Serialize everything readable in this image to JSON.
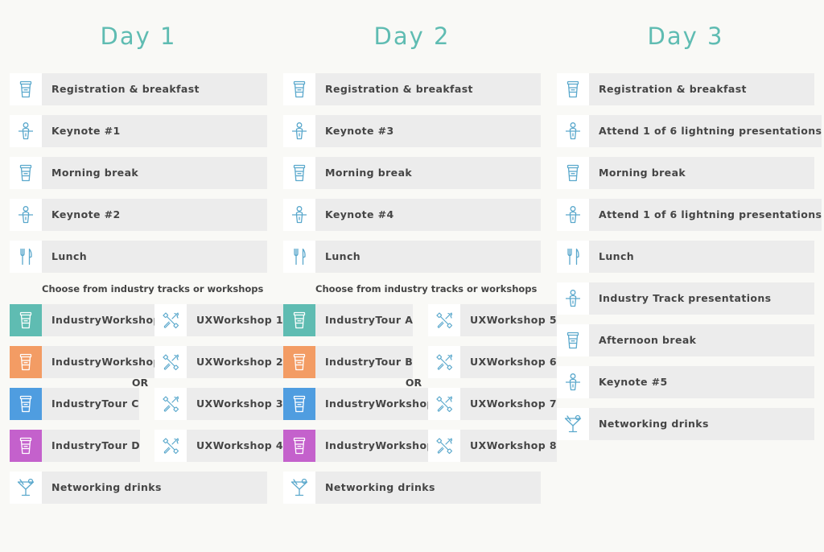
{
  "colors": {
    "title": "#5fbcb2",
    "icon_outline": "#5aa8cc",
    "teal": "#5fbcb2",
    "orange": "#f39c64",
    "blue": "#4f9de0",
    "purple": "#c461cc"
  },
  "days": [
    {
      "title": "Day 1",
      "sessions": [
        {
          "label": "Registration & breakfast",
          "icon": "coffee-cup-icon"
        },
        {
          "label": "Keynote #1",
          "icon": "speaker-podium-icon"
        },
        {
          "label": "Morning break",
          "icon": "coffee-cup-icon"
        },
        {
          "label": "Keynote #2",
          "icon": "speaker-podium-icon"
        },
        {
          "label": "Lunch",
          "icon": "fork-knife-icon"
        }
      ],
      "choose_text": "Choose from industry tracks or workshops",
      "or_text": "OR",
      "tracks": [
        {
          "label": "Industry\nWorkshop A",
          "color": "#5fbcb2",
          "icon": "coffee-cup-icon"
        },
        {
          "label": "Industry\nWorkshop B",
          "color": "#f39c64",
          "icon": "coffee-cup-icon"
        },
        {
          "label": "Industry\nTour C",
          "color": "#4f9de0",
          "icon": "coffee-cup-icon"
        },
        {
          "label": "Industry\nTour D",
          "color": "#c461cc",
          "icon": "coffee-cup-icon"
        }
      ],
      "workshops": [
        {
          "label": "UX\nWorkshop 1",
          "icon": "tools-icon"
        },
        {
          "label": "UX\nWorkshop 2",
          "icon": "tools-icon"
        },
        {
          "label": "UX\nWorkshop 3",
          "icon": "tools-icon"
        },
        {
          "label": "UX\nWorkshop 4",
          "icon": "tools-icon"
        }
      ],
      "closing": {
        "label": "Networking drinks",
        "icon": "cocktail-glass-icon"
      }
    },
    {
      "title": "Day 2",
      "sessions": [
        {
          "label": "Registration & breakfast",
          "icon": "coffee-cup-icon"
        },
        {
          "label": "Keynote #3",
          "icon": "speaker-podium-icon"
        },
        {
          "label": "Morning break",
          "icon": "coffee-cup-icon"
        },
        {
          "label": "Keynote #4",
          "icon": "speaker-podium-icon"
        },
        {
          "label": "Lunch",
          "icon": "fork-knife-icon"
        }
      ],
      "choose_text": "Choose from industry tracks or workshops",
      "or_text": "OR",
      "tracks": [
        {
          "label": "Industry\nTour A",
          "color": "#5fbcb2",
          "icon": "coffee-cup-icon"
        },
        {
          "label": "Industry\nTour B",
          "color": "#f39c64",
          "icon": "coffee-cup-icon"
        },
        {
          "label": "Industry\nWorkshop C",
          "color": "#4f9de0",
          "icon": "coffee-cup-icon"
        },
        {
          "label": "Industry\nWorkshop D",
          "color": "#c461cc",
          "icon": "coffee-cup-icon"
        }
      ],
      "workshops": [
        {
          "label": "UX\nWorkshop 5",
          "icon": "tools-icon"
        },
        {
          "label": "UX\nWorkshop 6",
          "icon": "tools-icon"
        },
        {
          "label": "UX\nWorkshop 7",
          "icon": "tools-icon"
        },
        {
          "label": "UX\nWorkshop 8",
          "icon": "tools-icon"
        }
      ],
      "closing": {
        "label": "Networking drinks",
        "icon": "cocktail-glass-icon"
      }
    },
    {
      "title": "Day 3",
      "sessions": [
        {
          "label": "Registration & breakfast",
          "icon": "coffee-cup-icon"
        },
        {
          "label": "Attend 1 of 6 lightning presentations",
          "icon": "speaker-podium-icon"
        },
        {
          "label": "Morning break",
          "icon": "coffee-cup-icon"
        },
        {
          "label": "Attend 1 of 6 lightning presentations",
          "icon": "speaker-podium-icon"
        },
        {
          "label": "Lunch",
          "icon": "fork-knife-icon"
        },
        {
          "label": "Industry Track presentations",
          "icon": "speaker-podium-icon"
        },
        {
          "label": "Afternoon break",
          "icon": "coffee-cup-icon"
        },
        {
          "label": "Keynote #5",
          "icon": "speaker-podium-icon"
        },
        {
          "label": "Networking drinks",
          "icon": "cocktail-glass-icon"
        }
      ]
    }
  ]
}
